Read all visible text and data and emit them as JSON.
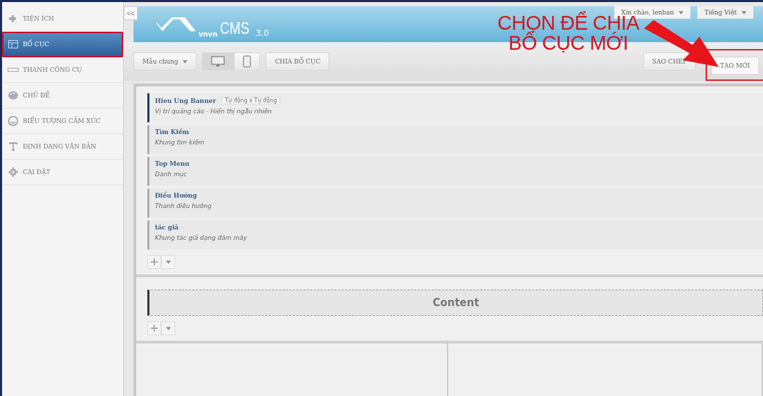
{
  "sidebar": {
    "collapse_label": "<<",
    "items": [
      {
        "label": "TIỆN ÍCH",
        "selected": false
      },
      {
        "label": "BỐ CỤC",
        "selected": true
      },
      {
        "label": "THANH CÔNG CỤ",
        "selected": false
      },
      {
        "label": "CHỦ ĐỀ",
        "selected": false
      },
      {
        "label": "BIỂU TƯỢNG CẢM XÚC",
        "selected": false
      },
      {
        "label": "ĐỊNH DẠNG VĂN BẢN",
        "selected": false
      },
      {
        "label": "CÀI ĐẶT",
        "selected": false
      }
    ]
  },
  "header": {
    "logo_small": "vnvn",
    "logo_name": "CMS",
    "logo_version": "3.0",
    "user_menu": "Xin chào, lenban",
    "language_menu": "Tiếng Việt"
  },
  "toolbar": {
    "template_select": "Mẫu chung",
    "devices": [
      {
        "kind": "desktop",
        "selected": true
      },
      {
        "kind": "mobile",
        "selected": false
      }
    ],
    "split_button": "CHIA BỐ CỤC",
    "copy_button": "SAO CHÉP",
    "new_button": "TẠO MỚI"
  },
  "annotation": {
    "lines": [
      "CHỌN ĐỂ CHIA",
      "BỔ CỤC MỚI"
    ]
  },
  "blocks": [
    {
      "title": "Hieu Ung Banner",
      "tag": "Tự động x Tự động",
      "subtitle": "Vị trí quảng cáo - Hiển thị ngẫu nhiên",
      "selected": true
    },
    {
      "title": "Tìm Kiếm",
      "subtitle": "Khung tìm kiếm",
      "selected": false
    },
    {
      "title": "Top Menu",
      "subtitle": "Danh mục",
      "selected": false
    },
    {
      "title": "Điều Hướng",
      "subtitle": "Thanh điều hướng",
      "selected": false
    },
    {
      "title": "tác giả",
      "subtitle": "Khung tác giả dạng đám mây",
      "selected": false
    }
  ],
  "content_region": {
    "label": "Content"
  }
}
